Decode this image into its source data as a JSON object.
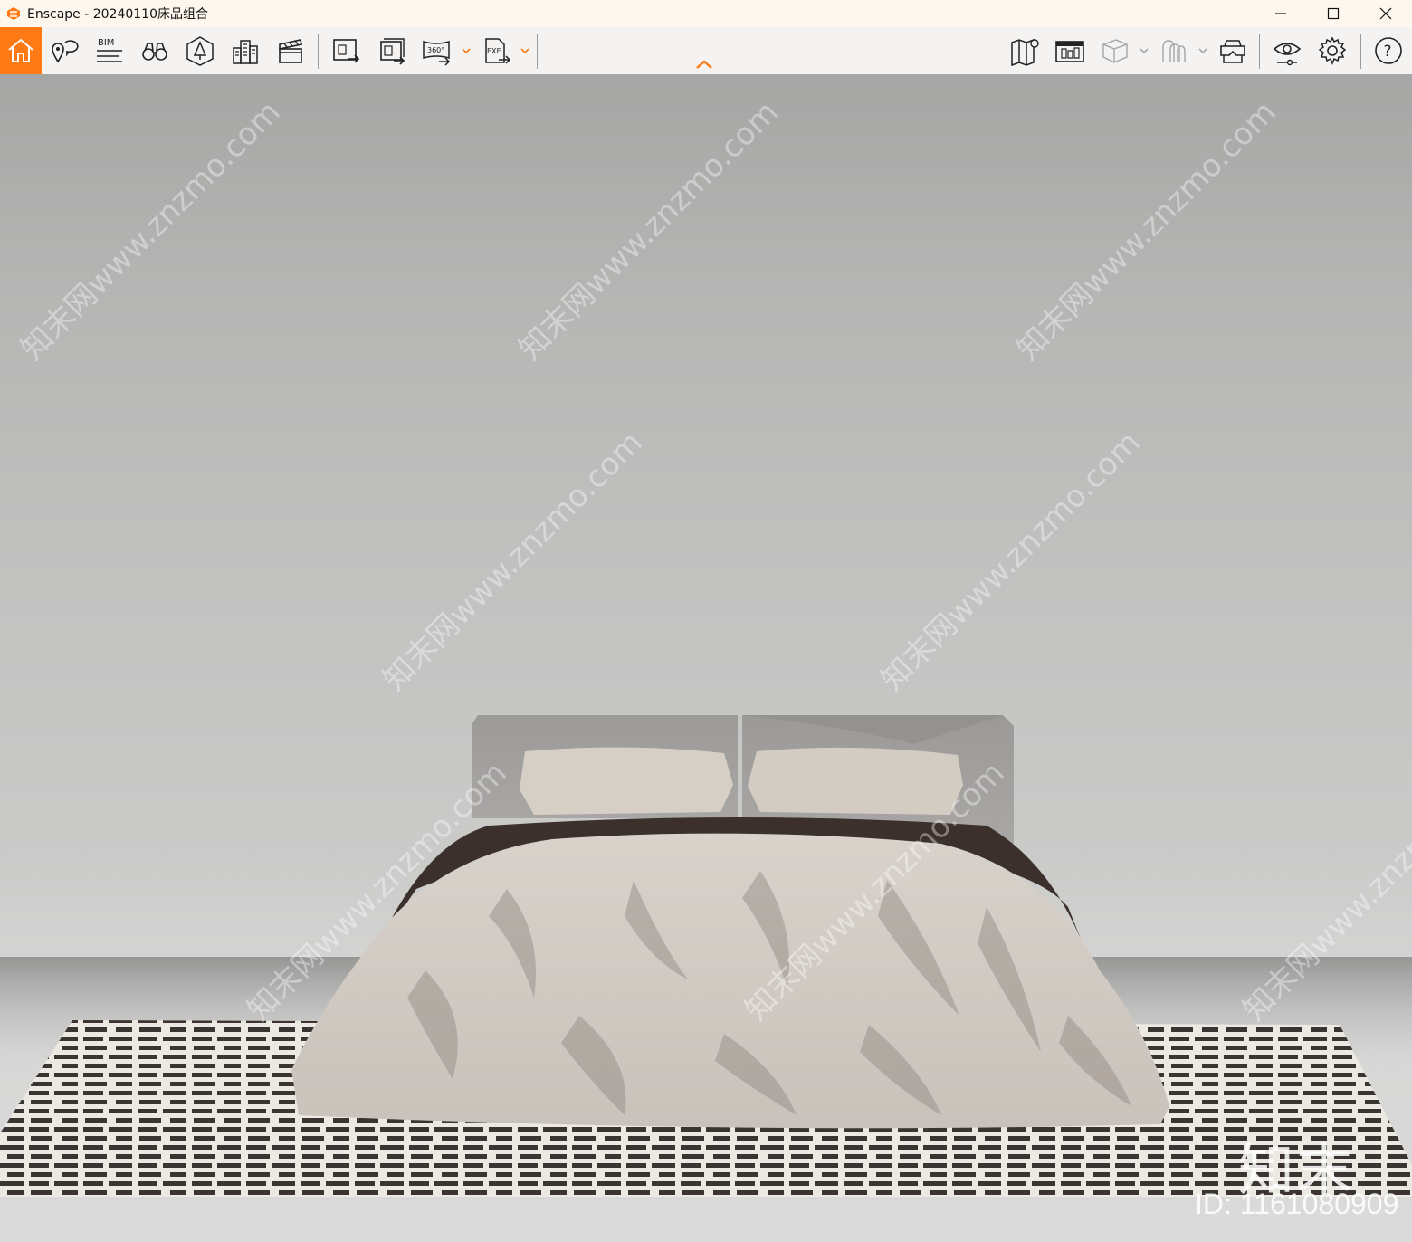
{
  "window": {
    "title": "Enscape - 20240110床品组合",
    "controls": [
      "minimize-icon",
      "maximize-icon",
      "close-icon"
    ]
  },
  "toolbar": {
    "left_group": [
      {
        "name": "home-icon",
        "active": true
      },
      {
        "name": "location-pin-icon"
      },
      {
        "name": "bim-icon",
        "label": "BIM"
      },
      {
        "name": "binoculars-icon"
      },
      {
        "name": "vegetation-icon"
      },
      {
        "name": "buildings-icon"
      },
      {
        "name": "clapperboard-icon"
      }
    ],
    "export_group": [
      {
        "name": "render-image-icon"
      },
      {
        "name": "batch-render-icon"
      },
      {
        "name": "panorama-360-icon",
        "label": "360°",
        "has_dropdown": true
      },
      {
        "name": "export-exe-icon",
        "label": "EXE",
        "has_dropdown": true
      }
    ],
    "right_group": [
      {
        "name": "map-icon"
      },
      {
        "name": "asset-library-icon"
      },
      {
        "name": "view-cube-icon",
        "has_dropdown": true,
        "disabled": true
      },
      {
        "name": "collaboration-icon",
        "has_dropdown": true,
        "disabled": true
      },
      {
        "name": "vr-headset-icon"
      },
      {
        "name": "visual-settings-icon"
      },
      {
        "name": "settings-gear-icon"
      },
      {
        "name": "help-icon",
        "label": "?"
      }
    ],
    "accent_color": "#ff7a14"
  },
  "viewport": {
    "watermark": "知末网www.znzmo.com",
    "brand": "知末",
    "image_id": "ID: 1161080909"
  }
}
